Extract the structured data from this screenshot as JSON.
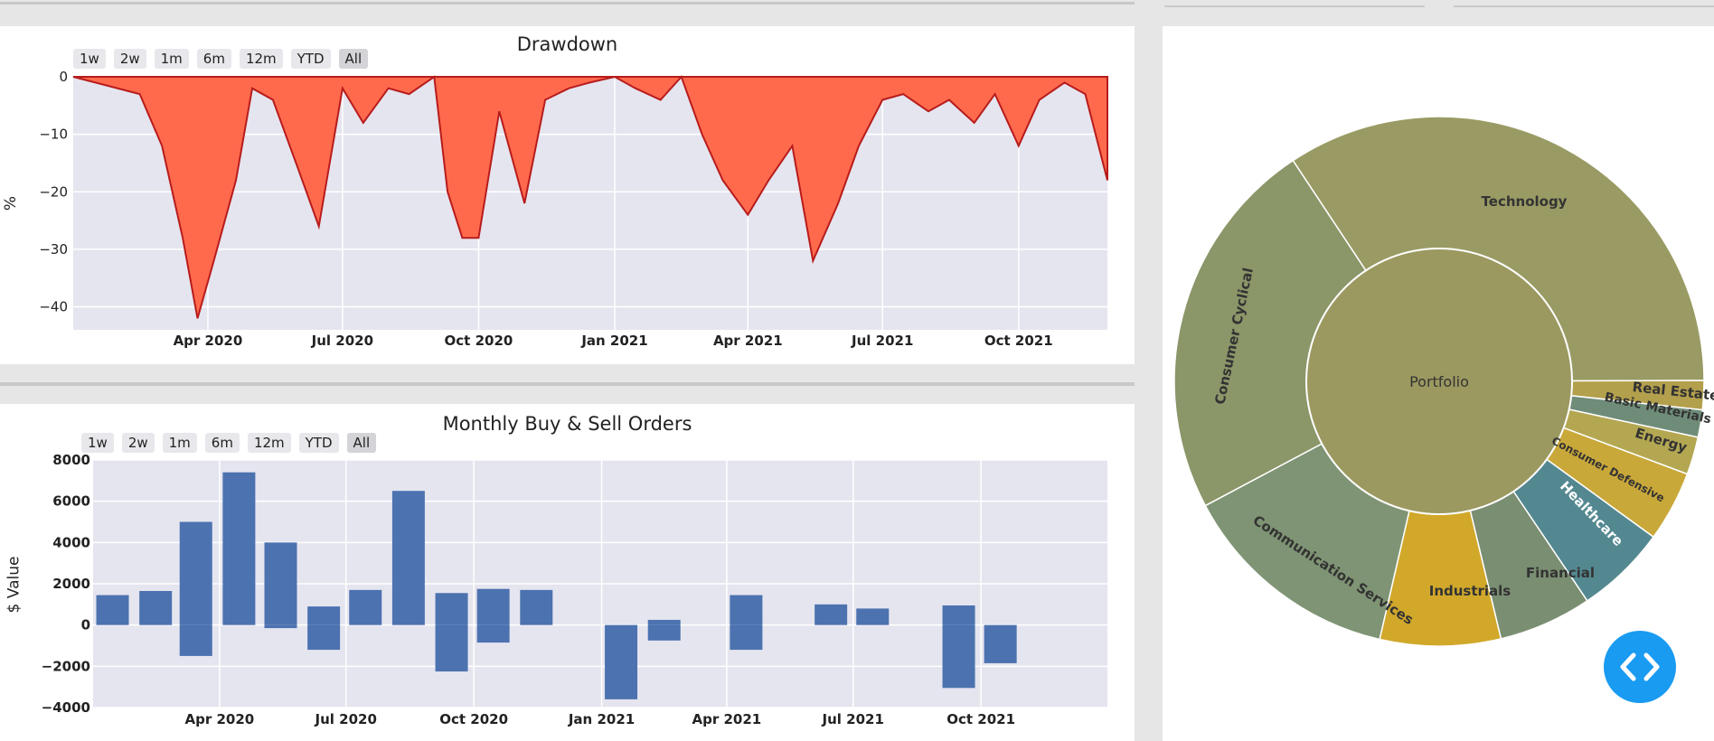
{
  "range_selector_buttons": [
    "1w",
    "2w",
    "1m",
    "6m",
    "12m",
    "YTD",
    "All"
  ],
  "range_selector_active": "All",
  "colors": {
    "drawdown_fill": "#ff6a4d",
    "drawdown_line": "#b71c1c",
    "bar_fill": "#4c72b0",
    "plot_bg": "#e5e5ef",
    "code_button": "#1a9bf2"
  },
  "drawdown": {
    "title": "Drawdown",
    "ylabel": "%",
    "yticks": [
      "0",
      "−10",
      "−20",
      "−30",
      "−40"
    ],
    "xticks": [
      "Apr 2020",
      "Jul 2020",
      "Oct 2020",
      "Jan 2021",
      "Apr 2021",
      "Jul 2021",
      "Oct 2021"
    ]
  },
  "orders": {
    "title": "Monthly Buy & Sell Orders",
    "ylabel": "$ Value",
    "yticks": [
      "8000",
      "6000",
      "4000",
      "2000",
      "0",
      "−2000",
      "−4000"
    ],
    "xticks": [
      "Apr 2020",
      "Jul 2020",
      "Oct 2020",
      "Jan 2021",
      "Apr 2021",
      "Jul 2021",
      "Oct 2021"
    ]
  },
  "sunburst": {
    "center_label": "Portfolio",
    "sectors": [
      {
        "label": "Technology",
        "color": "#9a9b64"
      },
      {
        "label": "Real Estate",
        "color": "#b3a04c"
      },
      {
        "label": "Basic Materials",
        "color": "#6f8c79"
      },
      {
        "label": "Energy",
        "color": "#b4a752"
      },
      {
        "label": "Consumer Defensive",
        "color": "#c9a83a"
      },
      {
        "label": "Healthcare",
        "color": "#548891"
      },
      {
        "label": "Financial",
        "color": "#7a8e72"
      },
      {
        "label": "Industrials",
        "color": "#d1a82a"
      },
      {
        "label": "Communication Services",
        "color": "#7f9474"
      },
      {
        "label": "Consumer Cyclical",
        "color": "#8b9669"
      }
    ]
  },
  "chart_data": [
    {
      "type": "area",
      "title": "Drawdown",
      "xlabel": "",
      "ylabel": "%",
      "ylim": [
        -44,
        0
      ],
      "x": [
        "2020-01-01",
        "2020-02-15",
        "2020-03-01",
        "2020-03-15",
        "2020-03-25",
        "2020-04-05",
        "2020-04-20",
        "2020-05-01",
        "2020-05-15",
        "2020-06-01",
        "2020-06-15",
        "2020-07-01",
        "2020-07-15",
        "2020-08-01",
        "2020-08-15",
        "2020-09-01",
        "2020-09-10",
        "2020-09-20",
        "2020-10-01",
        "2020-10-15",
        "2020-11-01",
        "2020-11-15",
        "2020-12-01",
        "2020-12-15",
        "2021-01-01",
        "2021-01-15",
        "2021-02-01",
        "2021-02-15",
        "2021-03-01",
        "2021-03-15",
        "2021-04-01",
        "2021-04-15",
        "2021-05-01",
        "2021-05-15",
        "2021-06-01",
        "2021-06-15",
        "2021-07-01",
        "2021-07-15",
        "2021-08-01",
        "2021-08-15",
        "2021-09-01",
        "2021-09-15",
        "2021-10-01",
        "2021-10-15",
        "2021-11-01",
        "2021-11-15",
        "2021-11-30"
      ],
      "values": [
        0,
        -3,
        -12,
        -28,
        -42,
        -32,
        -18,
        -2,
        -4,
        -16,
        -26,
        -2,
        -8,
        -2,
        -3,
        0,
        -20,
        -28,
        -28,
        -6,
        -22,
        -4,
        -2,
        -1,
        0,
        -2,
        -4,
        0,
        -10,
        -18,
        -24,
        -18,
        -12,
        -32,
        -22,
        -12,
        -4,
        -3,
        -6,
        -4,
        -8,
        -3,
        -12,
        -4,
        -1,
        -3,
        -18
      ],
      "xticks": [
        "Apr 2020",
        "Jul 2020",
        "Oct 2020",
        "Jan 2021",
        "Apr 2021",
        "Jul 2021",
        "Oct 2021"
      ]
    },
    {
      "type": "bar",
      "title": "Monthly Buy & Sell Orders",
      "xlabel": "",
      "ylabel": "$ Value",
      "ylim": [
        -4000,
        8000
      ],
      "categories": [
        "2020-01",
        "2020-02",
        "2020-03",
        "2020-04",
        "2020-05",
        "2020-06",
        "2020-07",
        "2020-08",
        "2020-09",
        "2020-10",
        "2020-11",
        "2020-12",
        "2021-01",
        "2021-02",
        "2021-03",
        "2021-04",
        "2021-05",
        "2021-06",
        "2021-07",
        "2021-08",
        "2021-09",
        "2021-10",
        "2021-11"
      ],
      "buy_values": [
        1450,
        1650,
        5000,
        7400,
        4000,
        900,
        1700,
        6500,
        1550,
        1750,
        1700,
        0,
        0,
        250,
        0,
        1450,
        0,
        1000,
        800,
        0,
        950,
        0,
        0
      ],
      "sell_values": [
        0,
        0,
        -1500,
        0,
        -150,
        -1200,
        0,
        0,
        -2250,
        -850,
        0,
        0,
        -3600,
        -750,
        0,
        -1200,
        0,
        0,
        0,
        0,
        -3050,
        -1850,
        0
      ],
      "xticks": [
        "Apr 2020",
        "Jul 2020",
        "Oct 2020",
        "Jan 2021",
        "Apr 2021",
        "Jul 2021",
        "Oct 2021"
      ]
    }
  ]
}
